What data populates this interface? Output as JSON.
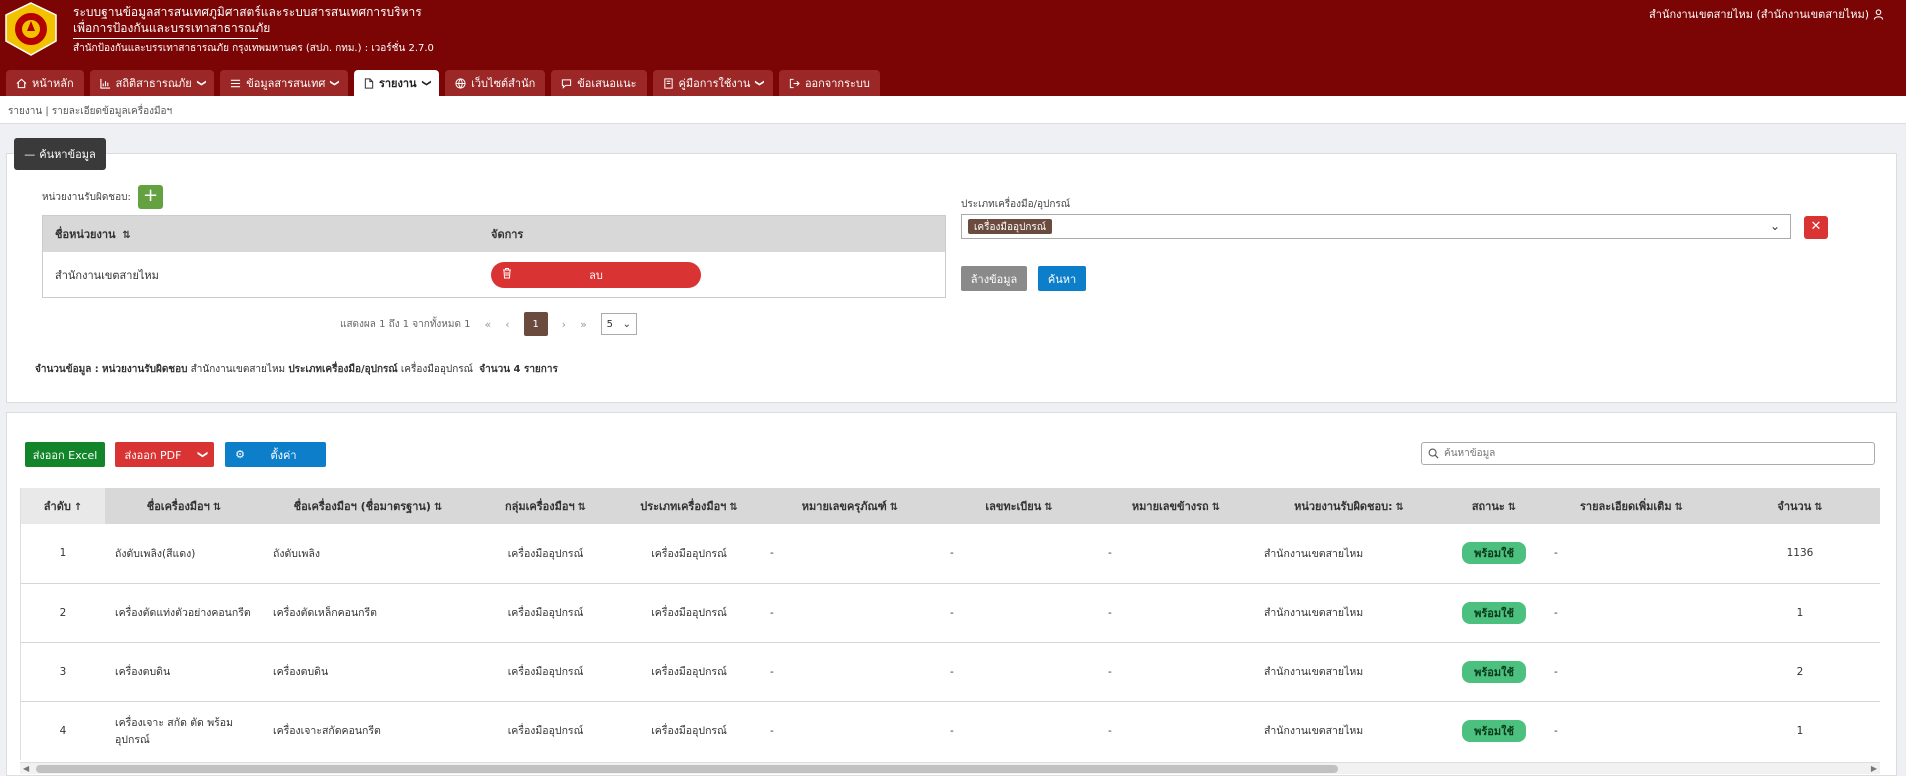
{
  "header": {
    "title_line1": "ระบบฐานข้อมูลสารสนเทศภูมิศาสตร์และระบบสารสนเทศการบริหาร",
    "title_line2": "เพื่อการป้องกันและบรรเทาสาธารณภัย",
    "subtitle": "สำนักป้องกันและบรรเทาสาธารณภัย กรุงเทพมหานคร (สปภ. กทม.) : เวอร์ชั่น 2.7.0",
    "user": "สำนักงานเขตสายไหม (สำนักงานเขตสายไหม)",
    "brand_color": "#7b0404"
  },
  "nav": {
    "tabs": [
      {
        "label": "หน้าหลัก",
        "icon": "home-icon"
      },
      {
        "label": "สถิติสาธารณภัย",
        "icon": "chart-icon"
      },
      {
        "label": "ข้อมูลสารสนเทศ",
        "icon": "list-icon"
      },
      {
        "label": "รายงาน",
        "icon": "document-icon"
      },
      {
        "label": "เว็บไซต์สำนัก",
        "icon": "globe-icon"
      },
      {
        "label": "ข้อเสนอแนะ",
        "icon": "comment-icon"
      },
      {
        "label": "คู่มือการใช้งาน",
        "icon": "book-icon"
      },
      {
        "label": "ออกจากระบบ",
        "icon": "logout-icon"
      }
    ]
  },
  "breadcrumb": "รายงาน | รายละเอียดข้อมูลเครื่องมือฯ",
  "search_panel": {
    "toggle_label": "ค้นหาข้อมูล",
    "responsible_label": "หน่วยงานรับผิดชอบ:",
    "unit_table": {
      "col_name": "ชื่อหน่วยงาน",
      "col_manage": "จัดการ",
      "rows": [
        {
          "name": "สำนักงานเขตสายไหม",
          "delete_label": "ลบ"
        }
      ]
    },
    "pager": {
      "info": "แสดงผล 1 ถึง 1 จากทั้งหมด 1",
      "current": "1",
      "page_size": "5"
    },
    "summary": {
      "prefix": "จำนวนข้อมูล :",
      "resp_key": "หน่วยงานรับผิดชอบ",
      "resp_val": "สำนักงานเขตสายไหม",
      "type_key": "ประเภทเครื่องมือ/อุปกรณ์",
      "type_val": "เครื่องมืออุปกรณ์",
      "count_label": "จำนวน 4 รายการ"
    },
    "type_label": "ประเภทเครื่องมือ/อุปกรณ์",
    "type_selected": "เครื่องมืออุปกรณ์",
    "clear_label": "ล้างข้อมูล",
    "search_label": "ค้นหา"
  },
  "data_panel": {
    "excel_label": "ส่งออก Excel",
    "pdf_label": "ส่งออก PDF",
    "settings_label": "ตั้งค่า",
    "search_placeholder": "ค้นหาข้อมูล",
    "columns": [
      "ลำดับ",
      "ชื่อเครื่องมือฯ",
      "ชื่อเครื่องมือฯ (ชื่อมาตรฐาน)",
      "กลุ่มเครื่องมือฯ",
      "ประเภทเครื่องมือฯ",
      "หมายเลขครุภัณฑ์",
      "เลขทะเบียน",
      "หมายเลขข้างรถ",
      "หน่วยงานรับผิดชอบ:",
      "สถานะ",
      "รายละเอียดเพิ่มเติม",
      "จำนวน"
    ],
    "rows": [
      [
        "1",
        "ถังดับเพลิง(สีแดง)",
        "ถังดับเพลิง",
        "เครื่องมืออุปกรณ์",
        "เครื่องมืออุปกรณ์",
        "-",
        "-",
        "-",
        "สำนักงานเขตสายไหม",
        "พร้อมใช้",
        "-",
        "1136"
      ],
      [
        "2",
        "เครื่องตัดแท่งตัวอย่างคอนกรีต",
        "เครื่องตัดเหล็กคอนกรีต",
        "เครื่องมืออุปกรณ์",
        "เครื่องมืออุปกรณ์",
        "-",
        "-",
        "-",
        "สำนักงานเขตสายไหม",
        "พร้อมใช้",
        "-",
        "1"
      ],
      [
        "3",
        "เครื่องตบดิน",
        "เครื่องตบดิน",
        "เครื่องมืออุปกรณ์",
        "เครื่องมืออุปกรณ์",
        "-",
        "-",
        "-",
        "สำนักงานเขตสายไหม",
        "พร้อมใช้",
        "-",
        "2"
      ],
      [
        "4",
        "เครื่องเจาะ สกัด ตัด พร้อมอุปกรณ์",
        "เครื่องเจาะสกัดคอนกรีต",
        "เครื่องมืออุปกรณ์",
        "เครื่องมืออุปกรณ์",
        "-",
        "-",
        "-",
        "สำนักงานเขตสายไหม",
        "พร้อมใช้",
        "-",
        "1"
      ]
    ],
    "status_color": "#4cc07e"
  }
}
